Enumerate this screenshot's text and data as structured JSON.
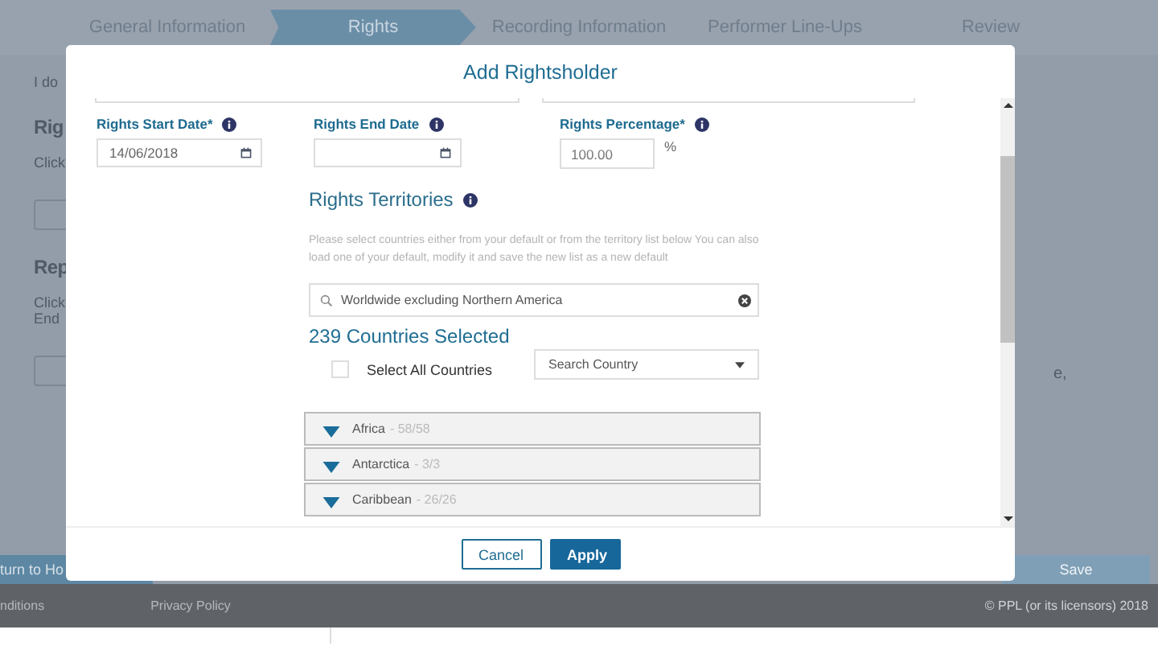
{
  "steps": [
    {
      "label": "General Information",
      "selected": false
    },
    {
      "label": "Rights",
      "selected": true
    },
    {
      "label": "Recording Information",
      "selected": false
    },
    {
      "label": "Performer Line-Ups",
      "selected": false
    },
    {
      "label": "Review",
      "selected": false
    }
  ],
  "background_page": {
    "intro": "I do",
    "heading_1": "Rig",
    "text_1": "Click",
    "heading_2": "Rep",
    "text_2": "Click",
    "text_3": "End",
    "side_text": "e,",
    "return_button": "turn to Ho",
    "save_button": "Save"
  },
  "footer": {
    "links": [
      "nditions",
      "Privacy Policy"
    ],
    "copyright": "© PPL (or its licensors) 2018"
  },
  "modal": {
    "title": "Add Rightsholder",
    "fields": [
      {
        "kind": "date",
        "label": "Rights Start Date*",
        "value": "14/06/2018"
      },
      {
        "kind": "date",
        "label": "Rights End Date"
      },
      {
        "kind": "number",
        "label": "Rights Percentage*",
        "value": "100.00",
        "suffix": "%"
      }
    ],
    "territories": {
      "title": "Rights Territories",
      "hint": "Please select countries either from your default or from the territory list below You can also load one of your default, modify it and save the new list as a new default",
      "filter": "Worldwide excluding Northern America",
      "count": "239 Countries Selected",
      "select_all": {
        "label": "Select All Countries",
        "checked": false
      },
      "search_country": {
        "placeholder": "Search Country"
      },
      "regions": [
        {
          "name": "Africa",
          "count": "- 58/58"
        },
        {
          "name": "Antarctica",
          "count": "- 3/3"
        },
        {
          "name": "Caribbean",
          "count": "- 26/26"
        }
      ]
    },
    "buttons": {
      "cancel": "Cancel",
      "apply": "Apply"
    }
  }
}
